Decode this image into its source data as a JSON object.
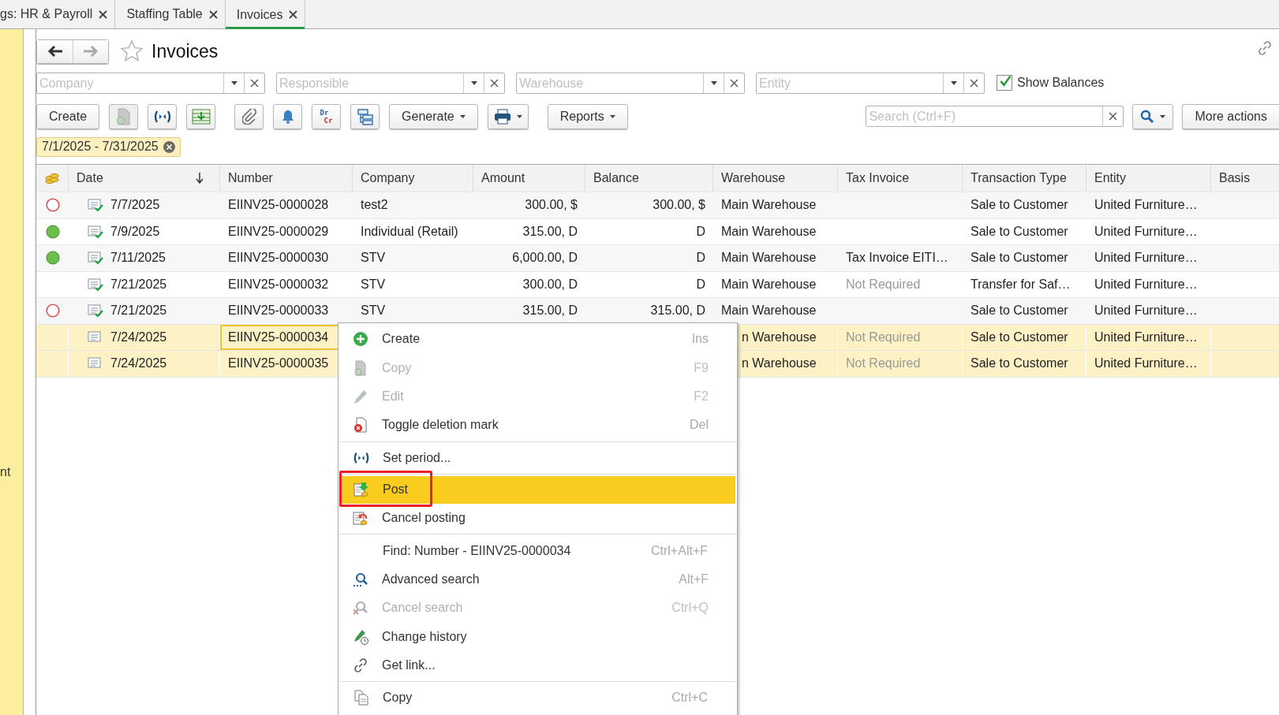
{
  "tabs": [
    {
      "label": "gs: HR & Payroll",
      "selected": false
    },
    {
      "label": "Staffing Table",
      "selected": false
    },
    {
      "label": "Invoices",
      "selected": true
    }
  ],
  "sidebar": {
    "text": "nt"
  },
  "header": {
    "back_disabled": false,
    "forward_disabled": true,
    "favorite": false,
    "title": "Invoices"
  },
  "filters": [
    {
      "placeholder": "Company"
    },
    {
      "placeholder": "Responsible"
    },
    {
      "placeholder": "Warehouse"
    },
    {
      "placeholder": "Entity"
    }
  ],
  "show_balances": {
    "label": "Show Balances",
    "checked": true
  },
  "toolbar": {
    "groups": [
      [
        {
          "kind": "text",
          "label": "Create",
          "disabled": false
        },
        {
          "kind": "copy",
          "disabled": true
        },
        {
          "kind": "period",
          "disabled": false
        },
        {
          "kind": "load",
          "disabled": false
        }
      ],
      [
        {
          "kind": "attach",
          "disabled": false
        },
        {
          "kind": "reminder",
          "disabled": false
        },
        {
          "kind": "ledger",
          "lines": [
            "Dr",
            "Cr"
          ],
          "disabled": false
        },
        {
          "kind": "structure",
          "disabled": false
        },
        {
          "kind": "dropdown",
          "label": "Generate",
          "disabled": false
        },
        {
          "kind": "print",
          "disabled": false
        }
      ],
      [
        {
          "kind": "dropdown",
          "label": "Reports",
          "disabled": false
        }
      ]
    ],
    "search": {
      "placeholder": "Search (Ctrl+F)"
    },
    "more": "More actions"
  },
  "period": "7/1/2025 - 7/31/2025",
  "table": {
    "columns": [
      {
        "label": "Date",
        "kind": "date",
        "sorted": true
      },
      {
        "label": "Number",
        "kind": "number",
        "sorted": false
      },
      {
        "label": "Company",
        "kind": "text",
        "sorted": false
      },
      {
        "label": "Amount",
        "kind": "money",
        "sorted": false
      },
      {
        "label": "Balance",
        "kind": "money",
        "sorted": false
      },
      {
        "label": "Warehouse",
        "kind": "text",
        "sorted": false
      },
      {
        "label": "Tax Invoice",
        "kind": "tax",
        "sorted": false
      },
      {
        "label": "Transaction Type",
        "kind": "text",
        "sorted": false
      },
      {
        "label": "Entity",
        "kind": "text",
        "sorted": false
      },
      {
        "label": "Basis",
        "kind": "text",
        "sorted": false
      }
    ],
    "rows": [
      {
        "kind": "unpaid",
        "posted": true,
        "selected": false,
        "focused": false,
        "cells": [
          "7/7/2025",
          "EIINV25-0000028",
          "test2",
          "300.00, $",
          "300.00, $",
          "Main Warehouse",
          null,
          "Sale to Customer",
          "United Furniture…",
          null
        ]
      },
      {
        "kind": "paid",
        "posted": true,
        "selected": false,
        "focused": false,
        "cells": [
          "7/9/2025",
          "EIINV25-0000029",
          "Individual (Retail)",
          "315.00, D",
          "D",
          "Main Warehouse",
          null,
          "Sale to Customer",
          "United Furniture…",
          null
        ]
      },
      {
        "kind": "paid",
        "posted": true,
        "selected": false,
        "focused": false,
        "tax_invoice_muted": false,
        "cells": [
          "7/11/2025",
          "EIINV25-0000030",
          "STV",
          "6,000.00, D",
          "D",
          "Main Warehouse",
          "Tax Invoice EITI…",
          "Sale to Customer",
          "United Furniture…",
          null
        ]
      },
      {
        "kind": "plain",
        "posted": true,
        "selected": false,
        "focused": false,
        "tax_invoice_muted": true,
        "cells": [
          "7/21/2025",
          "EIINV25-0000032",
          "STV",
          "300.00, D",
          "D",
          "Main Warehouse",
          "Not Required",
          "Transfer for Saf…",
          "United Furniture…",
          null
        ]
      },
      {
        "kind": "unpaid",
        "posted": true,
        "selected": false,
        "focused": false,
        "cells": [
          "7/21/2025",
          "EIINV25-0000033",
          "STV",
          "315.00, D",
          "315.00, D",
          "Main Warehouse",
          null,
          "Sale to Customer",
          "United Furniture…",
          null
        ]
      },
      {
        "kind": "plain",
        "posted": false,
        "selected": true,
        "focused": true,
        "tax_invoice_muted": true,
        "cells": [
          "7/24/2025",
          "EIINV25-0000034",
          null,
          null,
          null,
          "n Warehouse",
          "Not Required",
          "Sale to Customer",
          "United Furniture…",
          null
        ]
      },
      {
        "kind": "plain",
        "posted": false,
        "selected": true,
        "focused": false,
        "tax_invoice_muted": true,
        "cells": [
          "7/24/2025",
          "EIINV25-0000035",
          null,
          null,
          null,
          "n Warehouse",
          "Not Required",
          "Sale to Customer",
          "United Furniture…",
          null
        ]
      }
    ]
  },
  "context_menu": [
    {
      "kind": "create",
      "label": "Create",
      "shortcut": "Ins",
      "disabled": false,
      "selected": false,
      "framed": false,
      "divider_before": false
    },
    {
      "kind": "copy",
      "label": "Copy",
      "shortcut": "F9",
      "disabled": true,
      "selected": false,
      "framed": false,
      "divider_before": false
    },
    {
      "kind": "edit",
      "label": "Edit",
      "shortcut": "F2",
      "disabled": true,
      "selected": false,
      "framed": false,
      "divider_before": false
    },
    {
      "kind": "mark",
      "label": "Toggle deletion mark",
      "shortcut": "Del",
      "disabled": false,
      "selected": false,
      "framed": false,
      "divider_before": false
    },
    {
      "kind": "period",
      "label": "Set period...",
      "disabled": false,
      "selected": false,
      "framed": false,
      "divider_before": true
    },
    {
      "kind": "post",
      "label": "Post",
      "disabled": false,
      "selected": true,
      "framed": true,
      "divider_before": true
    },
    {
      "kind": "unpost",
      "label": "Cancel posting",
      "disabled": false,
      "selected": false,
      "framed": false,
      "divider_before": false
    },
    {
      "kind": "find",
      "label": "Find: Number - EIINV25-0000034",
      "shortcut": "Ctrl+Alt+F",
      "disabled": false,
      "selected": false,
      "framed": false,
      "divider_before": true
    },
    {
      "kind": "search",
      "label": "Advanced search",
      "shortcut": "Alt+F",
      "disabled": false,
      "selected": false,
      "framed": false,
      "divider_before": false
    },
    {
      "kind": "unsearch",
      "label": "Cancel search",
      "shortcut": "Ctrl+Q",
      "disabled": true,
      "selected": false,
      "framed": false,
      "divider_before": false
    },
    {
      "kind": "history",
      "label": "Change history",
      "disabled": false,
      "selected": false,
      "framed": false,
      "divider_before": false
    },
    {
      "kind": "link",
      "label": "Get link...",
      "disabled": false,
      "selected": false,
      "framed": false,
      "divider_before": false
    },
    {
      "kind": "clipboard",
      "label": "Copy",
      "shortcut": "Ctrl+C",
      "disabled": false,
      "selected": false,
      "framed": false,
      "divider_before": true
    }
  ]
}
